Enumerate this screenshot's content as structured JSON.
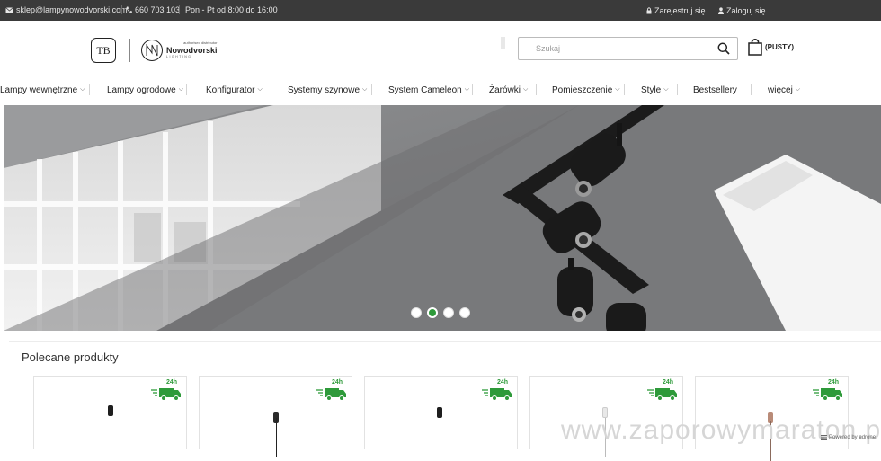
{
  "topbar": {
    "email": "sklep@lampynowodvorski.com",
    "phone": "660 703 103",
    "hours": "Pon - Pt od 8:00 do 16:00",
    "register": "Zarejestruj się",
    "login": "Zaloguj się"
  },
  "logo": {
    "mark_letters": "TB",
    "tagline": "authorised distributor",
    "brand": "Nowodvorski",
    "sub": "LIGHTING"
  },
  "search": {
    "placeholder": "Szukaj"
  },
  "cart": {
    "label": "(PUSTY)"
  },
  "nav": [
    {
      "label": "Lampy wewnętrzne",
      "chevron": true
    },
    {
      "label": "Lampy ogrodowe",
      "chevron": true
    },
    {
      "label": "Konfigurator",
      "chevron": true
    },
    {
      "label": "Systemy szynowe",
      "chevron": true
    },
    {
      "label": "System Cameleon",
      "chevron": true
    },
    {
      "label": "Żarówki",
      "chevron": true
    },
    {
      "label": "Pomieszczenie",
      "chevron": true
    },
    {
      "label": "Style",
      "chevron": true
    },
    {
      "label": "Bestsellery",
      "chevron": false
    },
    {
      "label": "więcej",
      "chevron": true
    }
  ],
  "slider": {
    "slide_count": 4,
    "active_index": 1
  },
  "section": {
    "title": "Polecane produkty"
  },
  "products": [
    {
      "badge": "24h",
      "bulb_color": "#1e1e1e"
    },
    {
      "badge": "24h",
      "bulb_color": "#2a2a2a"
    },
    {
      "badge": "24h",
      "bulb_color": "#1e1e1e"
    },
    {
      "badge": "24h",
      "bulb_color": "#e8e8e8"
    },
    {
      "badge": "24h",
      "bulb_color": "#b98b78"
    }
  ],
  "watermark": "www.zaporowymaraton.pl",
  "powered_by": "Powered by edrone",
  "colors": {
    "topbar": "#3a3a3a",
    "accent_green": "#2e9a3a"
  }
}
